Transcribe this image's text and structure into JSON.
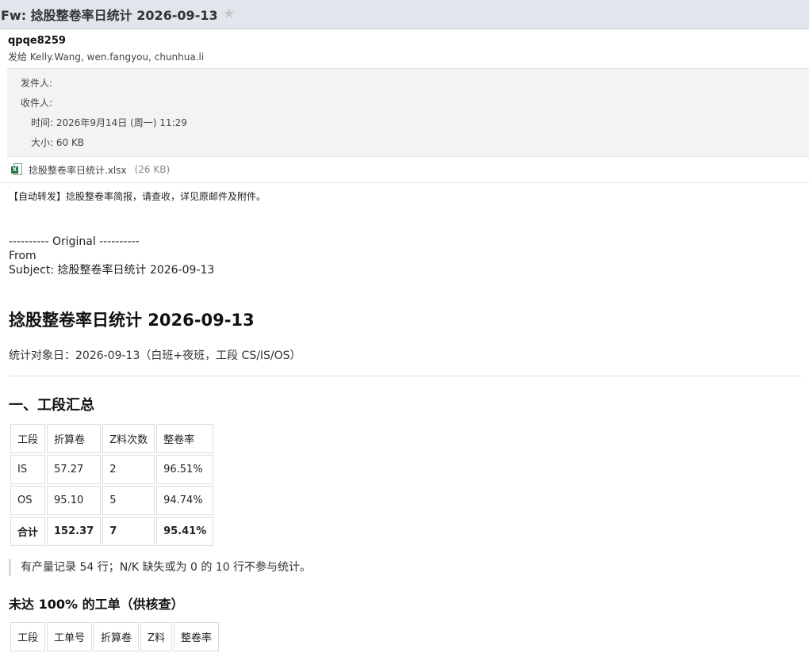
{
  "header": {
    "subject": "Fw: 捻股整卷率日统计 2026-09-13",
    "star_icon": "star-icon"
  },
  "sender": {
    "name": "qpqe8259",
    "to": "发给 Kelly.Wang, wen.fangyou, chunhua.li"
  },
  "meta": {
    "from_label": "发件人:",
    "to_label": "收件人:",
    "time": "时间: 2026年9月14日 (周一) 11:29",
    "size": "大小: 60 KB"
  },
  "attachment": {
    "name": "捻股整卷率日统计.xlsx",
    "size": "(26 KB)",
    "icon": "excel-file-icon"
  },
  "body": {
    "notice": "【自动转发】捻股整卷率简报，请查收，详见原邮件及附件。",
    "original_line": "---------- Original ----------",
    "from_line": "From",
    "subject_line": "Subject: 捻股整卷率日统计 2026-09-13",
    "report_title": "捻股整卷率日统计 2026-09-13",
    "object_line": "统计对象日：2026-09-13（白班+夜班，工段 CS/IS/OS）",
    "section1_title": "一、工段汇总",
    "summary_table": {
      "headers": [
        "工段",
        "折算卷",
        "Z料次数",
        "整卷率"
      ],
      "rows": [
        [
          "IS",
          "57.27",
          "2",
          "96.51%"
        ],
        [
          "OS",
          "95.10",
          "5",
          "94.74%"
        ],
        [
          "合计",
          "152.37",
          "7",
          "95.41%"
        ]
      ]
    },
    "note": "有产量记录 54 行；N/K 缺失或为 0 的 10 行不参与统计。",
    "section2_title": "未达 100% 的工单（供核查）",
    "detail_table": {
      "headers": [
        "工段",
        "工单号",
        "折算卷",
        "Z料",
        "整卷率"
      ]
    }
  }
}
